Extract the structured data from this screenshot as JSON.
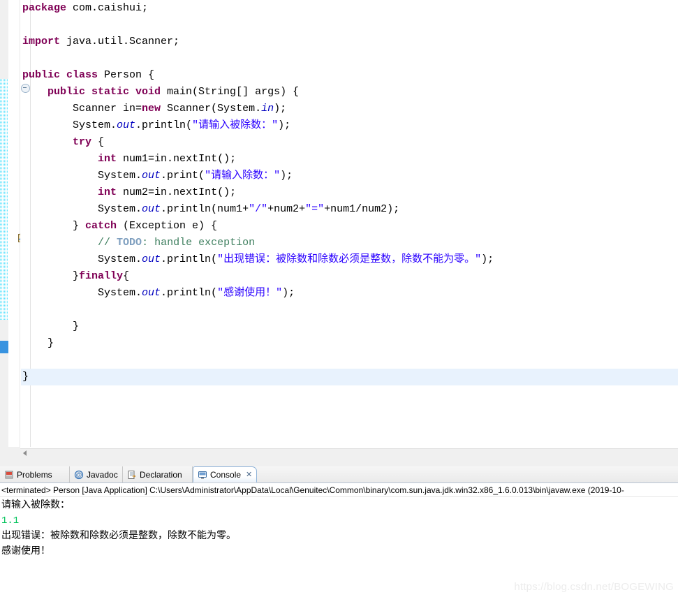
{
  "editor": {
    "gutter": {
      "fold_marker_icon": "collapse-minus-icon",
      "task_marker_icon": "todo-task-icon"
    },
    "current_line_index": 22,
    "lines": [
      [
        {
          "t": "package ",
          "c": "kw"
        },
        {
          "t": "com.caishui;",
          "c": "pln"
        }
      ],
      [],
      [
        {
          "t": "import ",
          "c": "kw"
        },
        {
          "t": "java.util.Scanner;",
          "c": "pln"
        }
      ],
      [],
      [
        {
          "t": "public class ",
          "c": "kw"
        },
        {
          "t": "Person {",
          "c": "pln"
        }
      ],
      [
        {
          "t": "    ",
          "c": "pln"
        },
        {
          "t": "public static void ",
          "c": "kw"
        },
        {
          "t": "main(String[] args) {",
          "c": "pln"
        }
      ],
      [
        {
          "t": "        Scanner in=",
          "c": "pln"
        },
        {
          "t": "new",
          "c": "kw"
        },
        {
          "t": " Scanner(System.",
          "c": "pln"
        },
        {
          "t": "in",
          "c": "fld"
        },
        {
          "t": ");",
          "c": "pln"
        }
      ],
      [
        {
          "t": "        System.",
          "c": "pln"
        },
        {
          "t": "out",
          "c": "fld"
        },
        {
          "t": ".println(",
          "c": "pln"
        },
        {
          "t": "\"请输入被除数：\"",
          "c": "str"
        },
        {
          "t": ");",
          "c": "pln"
        }
      ],
      [
        {
          "t": "        ",
          "c": "pln"
        },
        {
          "t": "try",
          "c": "kw"
        },
        {
          "t": " {",
          "c": "pln"
        }
      ],
      [
        {
          "t": "            ",
          "c": "pln"
        },
        {
          "t": "int",
          "c": "kw"
        },
        {
          "t": " num1=in.nextInt();",
          "c": "pln"
        }
      ],
      [
        {
          "t": "            System.",
          "c": "pln"
        },
        {
          "t": "out",
          "c": "fld"
        },
        {
          "t": ".print(",
          "c": "pln"
        },
        {
          "t": "\"请输入除数：\"",
          "c": "str"
        },
        {
          "t": ");",
          "c": "pln"
        }
      ],
      [
        {
          "t": "            ",
          "c": "pln"
        },
        {
          "t": "int",
          "c": "kw"
        },
        {
          "t": " num2=in.nextInt();",
          "c": "pln"
        }
      ],
      [
        {
          "t": "            System.",
          "c": "pln"
        },
        {
          "t": "out",
          "c": "fld"
        },
        {
          "t": ".println(num1+",
          "c": "pln"
        },
        {
          "t": "\"/\"",
          "c": "str"
        },
        {
          "t": "+num2+",
          "c": "pln"
        },
        {
          "t": "\"=\"",
          "c": "str"
        },
        {
          "t": "+num1/num2);",
          "c": "pln"
        }
      ],
      [
        {
          "t": "        } ",
          "c": "pln"
        },
        {
          "t": "catch",
          "c": "kw"
        },
        {
          "t": " (Exception e) {",
          "c": "pln"
        }
      ],
      [
        {
          "t": "            ",
          "c": "pln"
        },
        {
          "t": "// ",
          "c": "cmt"
        },
        {
          "t": "TODO",
          "c": "tdo"
        },
        {
          "t": ": handle exception",
          "c": "cmt"
        }
      ],
      [
        {
          "t": "            System.",
          "c": "pln"
        },
        {
          "t": "out",
          "c": "fld"
        },
        {
          "t": ".println(",
          "c": "pln"
        },
        {
          "t": "\"出现错误：被除数和除数必须是整数，除数不能为零。\"",
          "c": "str"
        },
        {
          "t": ");",
          "c": "pln"
        }
      ],
      [
        {
          "t": "        }",
          "c": "pln"
        },
        {
          "t": "finally",
          "c": "kw"
        },
        {
          "t": "{",
          "c": "pln"
        }
      ],
      [
        {
          "t": "            System.",
          "c": "pln"
        },
        {
          "t": "out",
          "c": "fld"
        },
        {
          "t": ".println(",
          "c": "pln"
        },
        {
          "t": "\"感谢使用！\"",
          "c": "str"
        },
        {
          "t": ");",
          "c": "pln"
        }
      ],
      [],
      [
        {
          "t": "        }",
          "c": "pln"
        }
      ],
      [
        {
          "t": "    }",
          "c": "pln"
        }
      ],
      [],
      [
        {
          "t": "}",
          "c": "pln"
        }
      ]
    ]
  },
  "view_stack": {
    "tabs": [
      {
        "label": "Problems",
        "icon": "problems-icon",
        "active": false,
        "closable": false
      },
      {
        "label": "Javadoc",
        "icon": "javadoc-at-icon",
        "active": false,
        "closable": false
      },
      {
        "label": "Declaration",
        "icon": "declaration-icon",
        "active": false,
        "closable": false
      },
      {
        "label": "Console",
        "icon": "console-icon",
        "active": true,
        "closable": true,
        "close_label": "✕"
      }
    ],
    "console": {
      "header": "<terminated> Person [Java Application] C:\\Users\\Administrator\\AppData\\Local\\Genuitec\\Common\\binary\\com.sun.java.jdk.win32.x86_1.6.0.013\\bin\\javaw.exe (2019-10-",
      "output": [
        {
          "text": "请输入被除数：",
          "stream": "stdout"
        },
        {
          "text": "1.1",
          "stream": "stdin"
        },
        {
          "text": "出现错误：被除数和除数必须是整数，除数不能为零。",
          "stream": "stdout"
        },
        {
          "text": "感谢使用！",
          "stream": "stdout"
        }
      ]
    }
  },
  "watermark": "https://blog.csdn.net/BOGEWING",
  "colors": {
    "keyword": "#7f0055",
    "string": "#2a00ff",
    "comment": "#3f7f5f",
    "todo_tag": "#7f9fbf",
    "static_field": "#0000c0",
    "stdin_green": "#00c25a",
    "current_line_highlight": "#e8f2fd",
    "change_bar_blue": "#2f8fe0"
  }
}
